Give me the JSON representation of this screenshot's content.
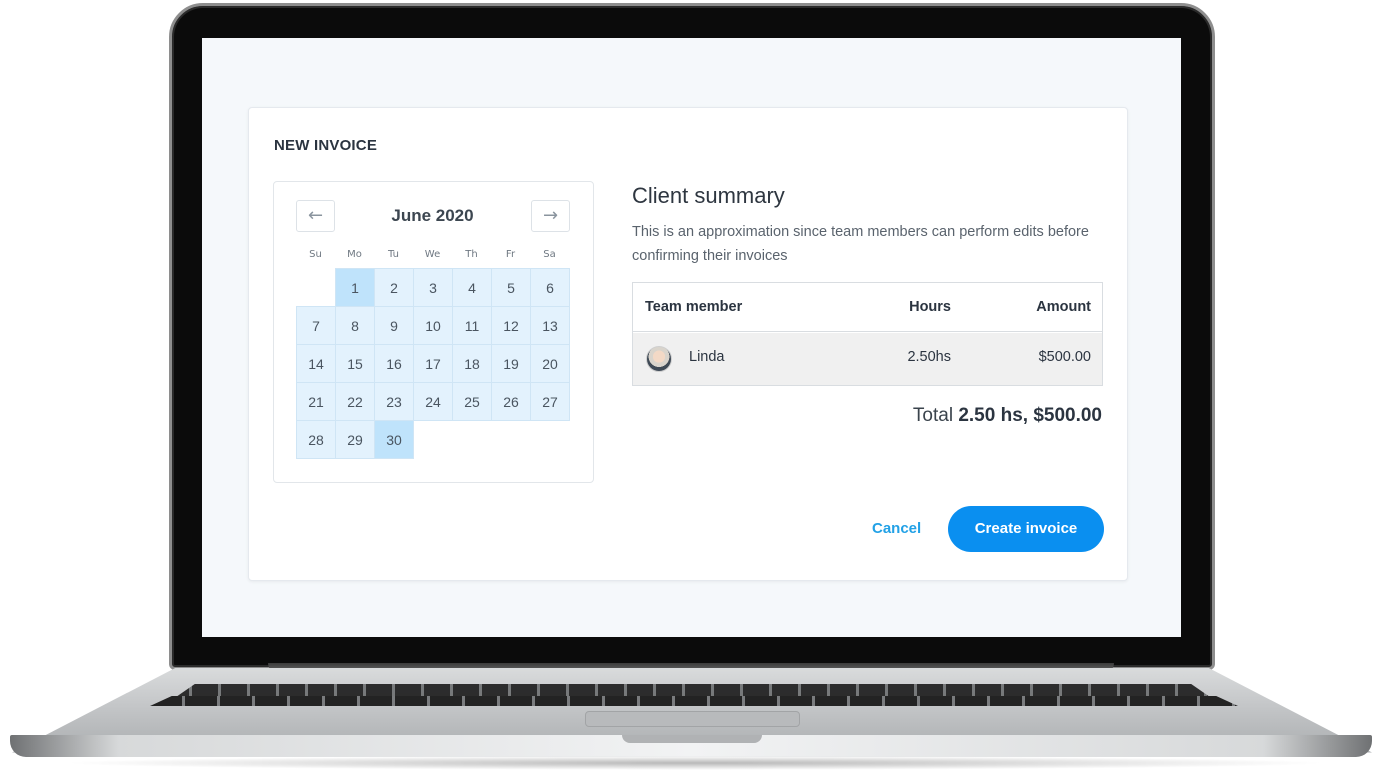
{
  "invoice": {
    "title": "NEW INVOICE",
    "calendar": {
      "prev_icon": "←",
      "next_icon": "→",
      "month_label": "June 2020",
      "weekdays": [
        "Su",
        "Mo",
        "Tu",
        "We",
        "Th",
        "Fr",
        "Sa"
      ],
      "leading_blank_days": 1,
      "days": [
        "1",
        "2",
        "3",
        "4",
        "5",
        "6",
        "7",
        "8",
        "9",
        "10",
        "11",
        "12",
        "13",
        "14",
        "15",
        "16",
        "17",
        "18",
        "19",
        "20",
        "21",
        "22",
        "23",
        "24",
        "25",
        "26",
        "27",
        "28",
        "29",
        "30"
      ],
      "selected_days": [
        "1",
        "30"
      ],
      "range_color": "#e3f2fd",
      "selected_color": "#bfe3fb"
    },
    "summary": {
      "title": "Client summary",
      "description": "This is an approximation since team members can perform edits before confirming their invoices",
      "columns": {
        "member": "Team member",
        "hours": "Hours",
        "amount": "Amount"
      },
      "rows": [
        {
          "avatar_icon": "user-avatar-icon",
          "member": "Linda",
          "hours": "2.50hs",
          "amount": "$500.00"
        }
      ],
      "total_label": "Total",
      "total_value": "2.50 hs, $500.00"
    },
    "actions": {
      "cancel_label": "Cancel",
      "create_label": "Create invoice",
      "accent_color": "#0a8ff0"
    }
  }
}
